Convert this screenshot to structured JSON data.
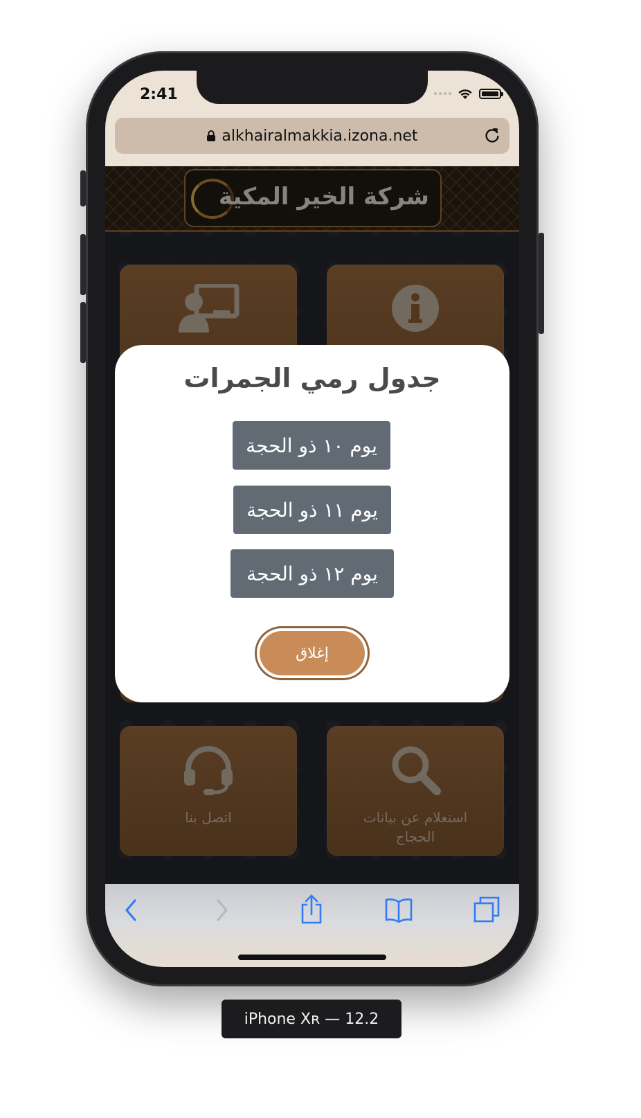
{
  "status_bar": {
    "time": "2:41"
  },
  "browser": {
    "url": "alkhairalmakkia.izona.net"
  },
  "header": {
    "banner_title": "شركة الخير المكية"
  },
  "tiles": [
    {
      "name": "presentation",
      "label": ""
    },
    {
      "name": "info",
      "label": ""
    },
    {
      "name": "contact",
      "label": "اتصل بنا"
    },
    {
      "name": "inquiry",
      "label": "استعلام عن بيانات الحجاج"
    }
  ],
  "modal": {
    "title": "جدول رمي الجمرات",
    "buttons": [
      "يوم ١٠ ذو الحجة",
      "يوم ١١ ذو الحجة",
      "يوم ١٢ ذو الحجة"
    ],
    "close_label": "إغلاق"
  },
  "device_caption": "iPhone Xʀ — 12.2",
  "colors": {
    "tile": "#8c5f36",
    "modal_button": "#626a74",
    "close_button": "#c98c58",
    "ios_tint": "#2f7cf6"
  },
  "icons": [
    "lock-icon",
    "reload-icon",
    "presentation-icon",
    "info-icon",
    "headset-icon",
    "search-icon",
    "back-icon",
    "forward-icon",
    "share-icon",
    "bookmarks-icon",
    "tabs-icon"
  ]
}
